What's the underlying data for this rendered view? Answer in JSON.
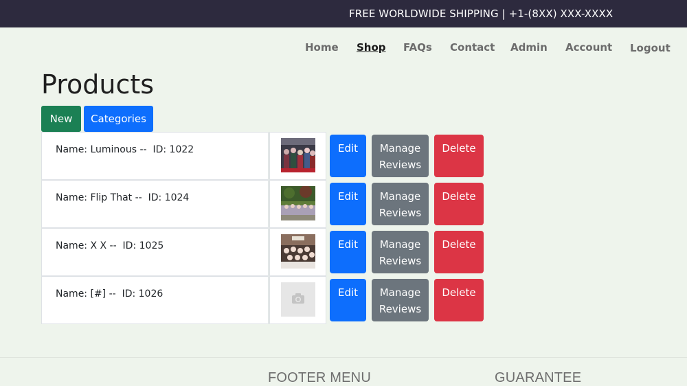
{
  "topbar": {
    "text": "FREE WORLDWIDE SHIPPING | +1-(8XX) XXX-XXXX"
  },
  "nav": {
    "items": [
      {
        "label": "Home"
      },
      {
        "label": "Shop",
        "active": true
      },
      {
        "label": "FAQs"
      },
      {
        "label": "Contact"
      },
      {
        "label": "Admin"
      },
      {
        "label": "Account"
      },
      {
        "label": "Logout"
      }
    ]
  },
  "page": {
    "title": "Products",
    "new_label": "New",
    "categories_label": "Categories"
  },
  "products": [
    {
      "name": "Name: Luminous --  ID: 1022",
      "has_image": true,
      "image_icon": "album-cover-thumbnail"
    },
    {
      "name": "Name: Flip That --  ID: 1024",
      "has_image": true,
      "image_icon": "album-cover-thumbnail"
    },
    {
      "name": "Name: X X --  ID: 1025",
      "has_image": true,
      "image_icon": "album-cover-thumbnail"
    },
    {
      "name": "Name: [#] --  ID: 1026",
      "has_image": false,
      "image_icon": "camera-placeholder-icon"
    }
  ],
  "actions": {
    "edit_label": "Edit",
    "manage_label_line1": "Manage",
    "manage_label_line2": "Reviews",
    "delete_label": "Delete"
  },
  "footer": {
    "menu_title": "FOOTER MENU",
    "guarantee_title": "GUARANTEE"
  },
  "colors": {
    "topbar": "#2d2a3e",
    "background": "#eef4ec",
    "primary": "#0d6efd",
    "success": "#1b8054",
    "secondary": "#6c757d",
    "danger": "#dc3545"
  }
}
